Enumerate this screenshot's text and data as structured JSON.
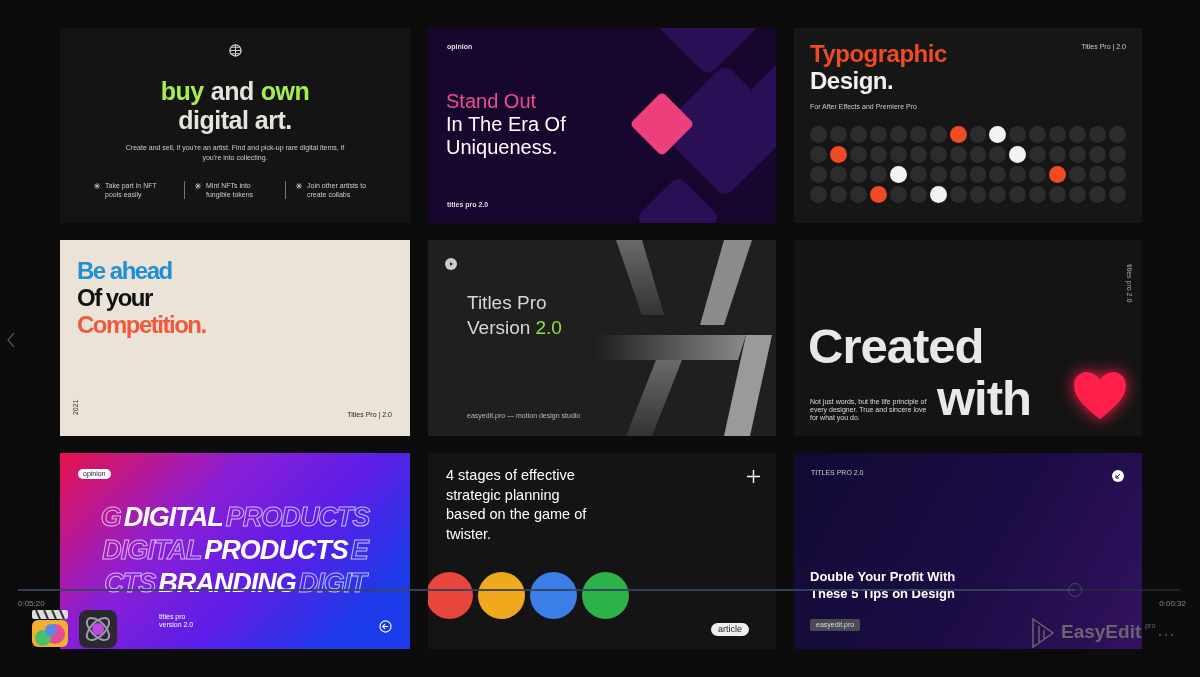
{
  "cards": [
    {
      "kind": "nft",
      "headline": [
        [
          {
            "text": "buy",
            "accent": true
          },
          {
            "text": "and",
            "accent": false
          },
          {
            "text": "own",
            "accent": true
          }
        ],
        [
          {
            "text": "digital art.",
            "accent": false
          }
        ]
      ],
      "body": "Create and sell, if you're an artist. Find and pick-up rare digital items, if you're into collecting.",
      "features": [
        "Take part in NFT pools easily",
        "Mint NFTs into fungible tokens",
        "Join other artists to create collabs"
      ]
    },
    {
      "kind": "diamond",
      "label": "opinion",
      "lines": [
        {
          "text": "Stand Out",
          "accent": true
        },
        {
          "text": "In The Era Of",
          "accent": false
        },
        {
          "text": "Uniqueness.",
          "accent": false
        }
      ],
      "footer": "titles pro 2.0"
    },
    {
      "kind": "dots",
      "title": [
        {
          "text": "Typographic",
          "accent": true
        },
        {
          "text": "Design.",
          "accent": false
        }
      ],
      "tag": "Titles Pro | 2.0",
      "subtitle": "For After Effects and Premiere Pro",
      "dot_rows": [
        [
          {
            "color": "#2c2c2c"
          },
          {
            "color": "#2c2c2c"
          },
          {
            "color": "#2c2c2c"
          },
          {
            "color": "#2c2c2c"
          },
          {
            "color": "#2c2c2c"
          },
          {
            "color": "#2c2c2c"
          },
          {
            "color": "#2c2c2c"
          },
          {
            "color": "#ee4b22"
          },
          {
            "color": "#2c2c2c"
          },
          {
            "color": "#f2f2f2"
          },
          {
            "color": "#2c2c2c"
          },
          {
            "color": "#2c2c2c"
          },
          {
            "color": "#2c2c2c"
          },
          {
            "color": "#2c2c2c"
          },
          {
            "color": "#2c2c2c"
          },
          {
            "color": "#2c2c2c"
          }
        ],
        [
          {
            "color": "#2c2c2c"
          },
          {
            "color": "#ee4b22"
          },
          {
            "color": "#2c2c2c"
          },
          {
            "color": "#2c2c2c"
          },
          {
            "color": "#2c2c2c"
          },
          {
            "color": "#2c2c2c"
          },
          {
            "color": "#2c2c2c"
          },
          {
            "color": "#2c2c2c"
          },
          {
            "color": "#2c2c2c"
          },
          {
            "color": "#2c2c2c"
          },
          {
            "color": "#f2f2f2"
          },
          {
            "color": "#2c2c2c"
          },
          {
            "color": "#2c2c2c"
          },
          {
            "color": "#2c2c2c"
          },
          {
            "color": "#2c2c2c"
          },
          {
            "color": "#2c2c2c"
          }
        ],
        [
          {
            "color": "#2c2c2c"
          },
          {
            "color": "#2c2c2c"
          },
          {
            "color": "#2c2c2c"
          },
          {
            "color": "#2c2c2c"
          },
          {
            "color": "#f2f2f2"
          },
          {
            "color": "#2c2c2c"
          },
          {
            "color": "#2c2c2c"
          },
          {
            "color": "#2c2c2c"
          },
          {
            "color": "#2c2c2c"
          },
          {
            "color": "#2c2c2c"
          },
          {
            "color": "#2c2c2c"
          },
          {
            "color": "#2c2c2c"
          },
          {
            "color": "#ee4b22"
          },
          {
            "color": "#2c2c2c"
          },
          {
            "color": "#2c2c2c"
          },
          {
            "color": "#2c2c2c"
          }
        ],
        [
          {
            "color": "#2c2c2c"
          },
          {
            "color": "#2c2c2c"
          },
          {
            "color": "#2c2c2c"
          },
          {
            "color": "#ee4b22"
          },
          {
            "color": "#2c2c2c"
          },
          {
            "color": "#2c2c2c"
          },
          {
            "color": "#f2f2f2"
          },
          {
            "color": "#2c2c2c"
          },
          {
            "color": "#2c2c2c"
          },
          {
            "color": "#2c2c2c"
          },
          {
            "color": "#2c2c2c"
          },
          {
            "color": "#2c2c2c"
          },
          {
            "color": "#2c2c2c"
          },
          {
            "color": "#2c2c2c"
          },
          {
            "color": "#2c2c2c"
          },
          {
            "color": "#2c2c2c"
          }
        ]
      ]
    },
    {
      "kind": "beige",
      "lines": [
        {
          "text": "Be ahead",
          "color": "#1e90d6"
        },
        {
          "text": "Of your",
          "color": "#111111"
        },
        {
          "text": "Competition.",
          "color": "#ef5a3c"
        }
      ],
      "year": "2021",
      "tag": "Titles Pro | 2.0"
    },
    {
      "kind": "version",
      "title": "Titles Pro",
      "version_label": "Version",
      "version": "2.0",
      "footer": "easyedit.pro — motion design studio"
    },
    {
      "kind": "heart",
      "side_label": "titles pro 2.0",
      "words": [
        "Created",
        "with"
      ],
      "body": "Not just words, but the life principle of every designer. True and sincere love for what you do."
    },
    {
      "kind": "marquee",
      "badge": "opinion",
      "rows": [
        [
          {
            "text": "G",
            "solid": false
          },
          {
            "text": "DIGITAL",
            "solid": true
          },
          {
            "text": "PRODUCTS",
            "solid": false
          }
        ],
        [
          {
            "text": "DIGITAL",
            "solid": false
          },
          {
            "text": "PRODUCTS",
            "solid": true
          },
          {
            "text": "E",
            "solid": false
          }
        ],
        [
          {
            "text": "CTS",
            "solid": false
          },
          {
            "text": "BRANDING",
            "solid": true
          },
          {
            "text": "DIGIT",
            "solid": false
          }
        ]
      ],
      "small_lines": [
        "titles pro",
        "version 2.0"
      ]
    },
    {
      "kind": "article",
      "text": "4 stages of effective strategic planning based on the game of twister.",
      "circles": [
        {
          "color": "#e8453c"
        },
        {
          "color": "#f0a81c"
        },
        {
          "color": "#3b7ee8"
        },
        {
          "color": "#2bb34a"
        }
      ],
      "tag": "article"
    },
    {
      "kind": "profit",
      "label": "TITLES PRO 2.0",
      "title": "Double Your Profit With These 5 Tips on Design",
      "tag": "easyedit.pro"
    }
  ],
  "player": {
    "elapsed": "0:05:20",
    "remaining": "0:00:32",
    "progress": {
      "level": 0.91
    },
    "logo": {
      "name": "EasyEdit",
      "suffix": ".pro"
    }
  }
}
